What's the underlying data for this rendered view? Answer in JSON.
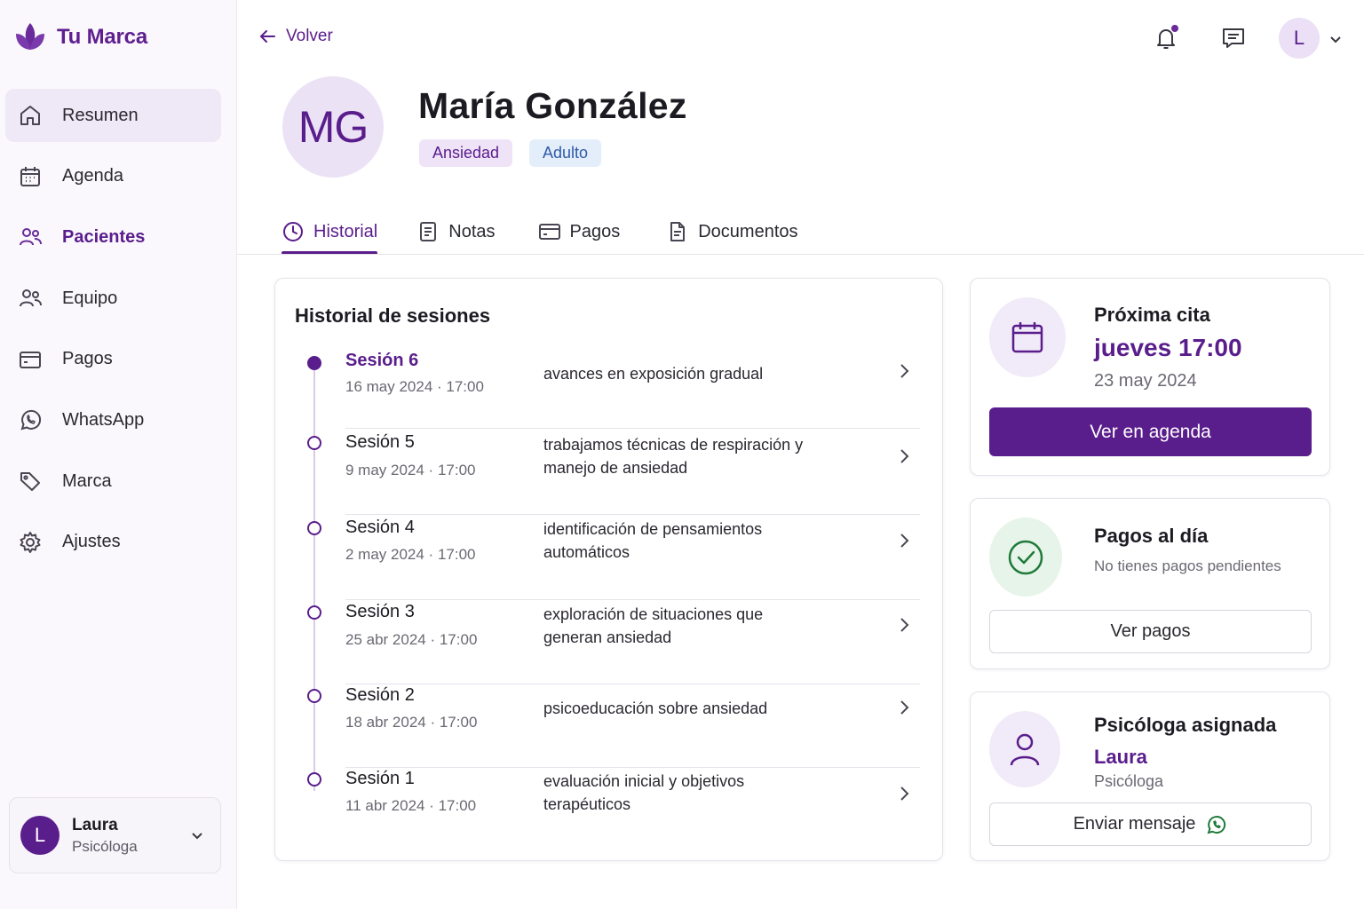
{
  "brand": {
    "name": "Tu Marca",
    "color": "#5a1d8c"
  },
  "sidebar": {
    "items": [
      {
        "label": "Resumen",
        "icon": "home-icon"
      },
      {
        "label": "Agenda",
        "icon": "calendar-icon"
      },
      {
        "label": "Pacientes",
        "icon": "users-icon"
      },
      {
        "label": "Equipo",
        "icon": "team-icon"
      },
      {
        "label": "Pagos",
        "icon": "card-icon"
      },
      {
        "label": "WhatsApp",
        "icon": "whatsapp-icon"
      },
      {
        "label": "Marca",
        "icon": "tag-icon"
      },
      {
        "label": "Ajustes",
        "icon": "gear-icon"
      }
    ],
    "user": {
      "initial": "L",
      "name": "Laura",
      "role": "Psicóloga"
    }
  },
  "header": {
    "back_label": "Volver",
    "avatar_initial": "L"
  },
  "patient": {
    "initials": "MG",
    "name": "María González",
    "tags": [
      "Ansiedad",
      "Adulto"
    ]
  },
  "tabs": [
    {
      "label": "Historial",
      "icon": "clock-icon"
    },
    {
      "label": "Notas",
      "icon": "notes-icon"
    },
    {
      "label": "Pagos",
      "icon": "card-icon"
    },
    {
      "label": "Documentos",
      "icon": "document-icon"
    }
  ],
  "history": {
    "title": "Historial de sesiones",
    "sessions": [
      {
        "title": "Sesión 6",
        "date": "16 may 2024 · 17:00",
        "note": "avances en exposición gradual"
      },
      {
        "title": "Sesión 5",
        "date": "9 may 2024 · 17:00",
        "note": "trabajamos técnicas de respiración y manejo de ansiedad"
      },
      {
        "title": "Sesión 4",
        "date": "2 may 2024 · 17:00",
        "note": "identificación de pensamientos automáticos"
      },
      {
        "title": "Sesión 3",
        "date": "25 abr 2024 · 17:00",
        "note": "exploración de situaciones que generan ansiedad"
      },
      {
        "title": "Sesión 2",
        "date": "18 abr 2024 · 17:00",
        "note": "psicoeducación sobre ansiedad"
      },
      {
        "title": "Sesión 1",
        "date": "11 abr 2024 · 17:00",
        "note": "evaluación inicial y objetivos terapéuticos"
      }
    ]
  },
  "next_appointment": {
    "title": "Próxima cita",
    "when": "jueves 17:00",
    "date": "23 may 2024",
    "button": "Ver en agenda"
  },
  "payments": {
    "title": "Pagos al día",
    "subtitle": "No tienes pagos pendientes",
    "button": "Ver pagos"
  },
  "assigned": {
    "title": "Psicóloga asignada",
    "name": "Laura",
    "role": "Psicóloga",
    "button": "Enviar mensaje"
  }
}
